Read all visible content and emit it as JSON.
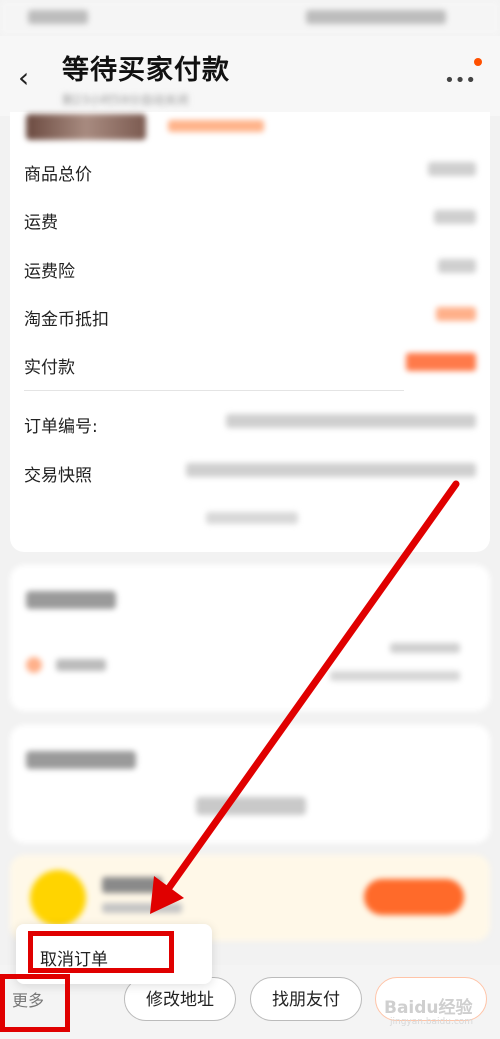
{
  "header": {
    "title": "等待买家付款",
    "back_icon": "chevron-left-icon",
    "more_icon": "more-dots-icon"
  },
  "order_details": {
    "rows": [
      {
        "label": "商品总价"
      },
      {
        "label": "运费"
      },
      {
        "label": "运费险"
      },
      {
        "label": "淘金币抵扣"
      },
      {
        "label": "实付款"
      }
    ],
    "order_number_label": "订单编号:",
    "snapshot_label": "交易快照"
  },
  "popup_menu": {
    "cancel_order": "取消订单"
  },
  "bottom_bar": {
    "more": "更多",
    "modify_address": "修改地址",
    "friend_pay": "找朋友付",
    "watermark": "Baidu经验",
    "watermark_sub": "jingyan.baidu.com"
  },
  "annotation": {
    "highlight_color": "#e00000"
  }
}
